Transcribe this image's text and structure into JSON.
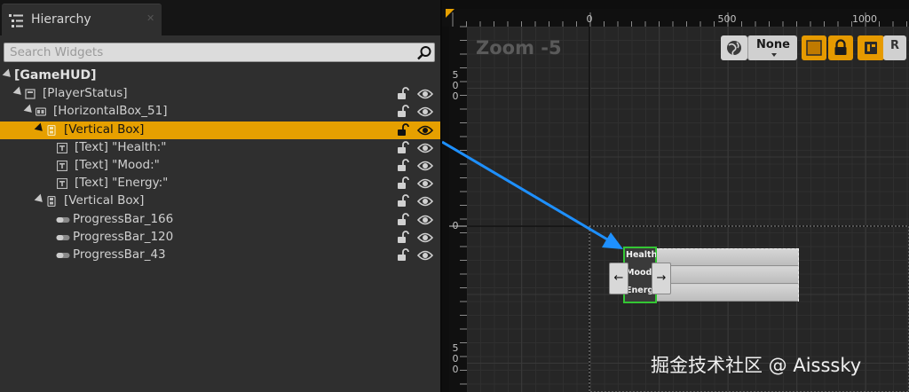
{
  "hierarchy": {
    "tab_title": "Hierarchy",
    "tab_close": "✕",
    "search": {
      "placeholder": "Search Widgets"
    },
    "tree": [
      {
        "label": "[GameHUD]",
        "icon": "none"
      },
      {
        "label": "[PlayerStatus]",
        "icon": "canvas-panel-icon"
      },
      {
        "label": "[HorizontalBox_51]",
        "icon": "horizontal-box-icon"
      },
      {
        "label": "[Vertical Box]",
        "icon": "vertical-box-icon",
        "selected": true
      },
      {
        "label": "[Text] \"Health:\"",
        "icon": "text-icon"
      },
      {
        "label": "[Text] \"Mood:\"",
        "icon": "text-icon"
      },
      {
        "label": "[Text] \"Energy:\"",
        "icon": "text-icon"
      },
      {
        "label": "[Vertical Box]",
        "icon": "vertical-box-icon"
      },
      {
        "label": "ProgressBar_166",
        "icon": "progress-bar-icon"
      },
      {
        "label": "ProgressBar_120",
        "icon": "progress-bar-icon"
      },
      {
        "label": "ProgressBar_43",
        "icon": "progress-bar-icon"
      }
    ]
  },
  "designer": {
    "zoom_label": "Zoom -5",
    "ruler_top": [
      "0",
      "500",
      "1000"
    ],
    "ruler_left": [
      "5\n0\n0",
      "0",
      "5\n0\n0"
    ],
    "toolbar": {
      "preview_size": "None",
      "r_label": "R"
    },
    "widget": {
      "texts": [
        "Health:",
        "Mood:",
        "Energy:"
      ],
      "arrow_left": "←",
      "arrow_right": "→"
    }
  },
  "watermark": "掘金技术社区 @ Aisssky",
  "colors": {
    "selection": "#e6a000",
    "panel_bg": "#2f2f2f",
    "viewport_bg": "#0e0e0e",
    "widget_outline": "#34c634",
    "annotation_arrow": "#1e90ff"
  }
}
